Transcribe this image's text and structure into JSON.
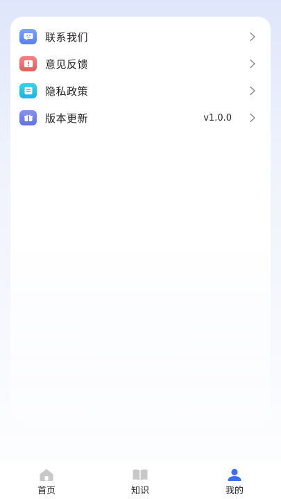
{
  "menu": {
    "items": [
      {
        "label": "联系我们",
        "icon": "chat-smile-icon",
        "color": "#6b8ff3"
      },
      {
        "label": "意见反馈",
        "icon": "alert-icon",
        "color": "#ea6f6f"
      },
      {
        "label": "隐私政策",
        "icon": "document-icon",
        "color": "#27c3e3"
      },
      {
        "label": "版本更新",
        "icon": "gift-icon",
        "color": "#6f7fe8",
        "value": "v1.0.0"
      }
    ]
  },
  "tabbar": {
    "tabs": [
      {
        "label": "首页",
        "icon": "home-icon",
        "active": false
      },
      {
        "label": "知识",
        "icon": "book-icon",
        "active": false
      },
      {
        "label": "我的",
        "icon": "user-icon",
        "active": true
      }
    ],
    "active_color": "#3b6ef5",
    "inactive_color": "#c8c8c8"
  }
}
